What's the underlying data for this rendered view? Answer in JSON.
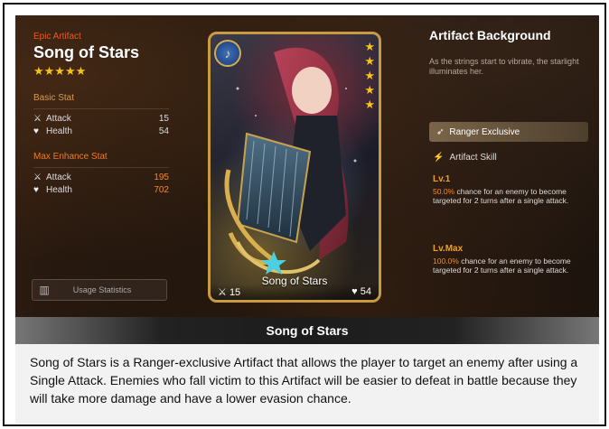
{
  "artifact": {
    "rarity": "Epic Artifact",
    "name": "Song of Stars",
    "stars": "★★★★★"
  },
  "basic_stat": {
    "title": "Basic Stat",
    "attack_label": "Attack",
    "attack_value": "15",
    "health_label": "Health",
    "health_value": "54"
  },
  "max_enhance_stat": {
    "title": "Max Enhance Stat",
    "attack_label": "Attack",
    "attack_value": "195",
    "health_label": "Health",
    "health_value": "702"
  },
  "usage_button": {
    "label": "Usage Statistics"
  },
  "card": {
    "title": "Song of Stars",
    "attack": "15",
    "health": "54",
    "stars": [
      "★",
      "★",
      "★",
      "★",
      "★"
    ]
  },
  "background": {
    "title": "Artifact Background",
    "description": "As the strings start to vibrate, the starlight illuminates her."
  },
  "exclusive": {
    "label": "Ranger Exclusive"
  },
  "skill": {
    "header": "Artifact Skill",
    "lv1": {
      "title": "Lv.1",
      "percent": "50.0%",
      "text": " chance for an enemy to become targeted for 2 turns after a single attack."
    },
    "lvmax": {
      "title": "Lv.Max",
      "percent": "100.0%",
      "text": " chance for an enemy to become targeted for 2 turns after a single attack."
    }
  },
  "caption": {
    "title": "Song of Stars",
    "body": "Song of Stars is a Ranger-exclusive Artifact that allows the player to target an enemy after using a Single Attack. Enemies who fall victim to this Artifact will be easier to defeat in battle because they will take more damage and have a lower evasion chance."
  },
  "colors": {
    "rarity": "#e85a2a",
    "star": "#f5c21a",
    "max_stat": "#f28a2a",
    "card_border": "#c89a42"
  },
  "icons": {
    "attack": "sword-icon",
    "health": "heart-icon",
    "usage": "chart-icon",
    "exclusive": "bow-icon",
    "skill": "lightning-icon"
  }
}
